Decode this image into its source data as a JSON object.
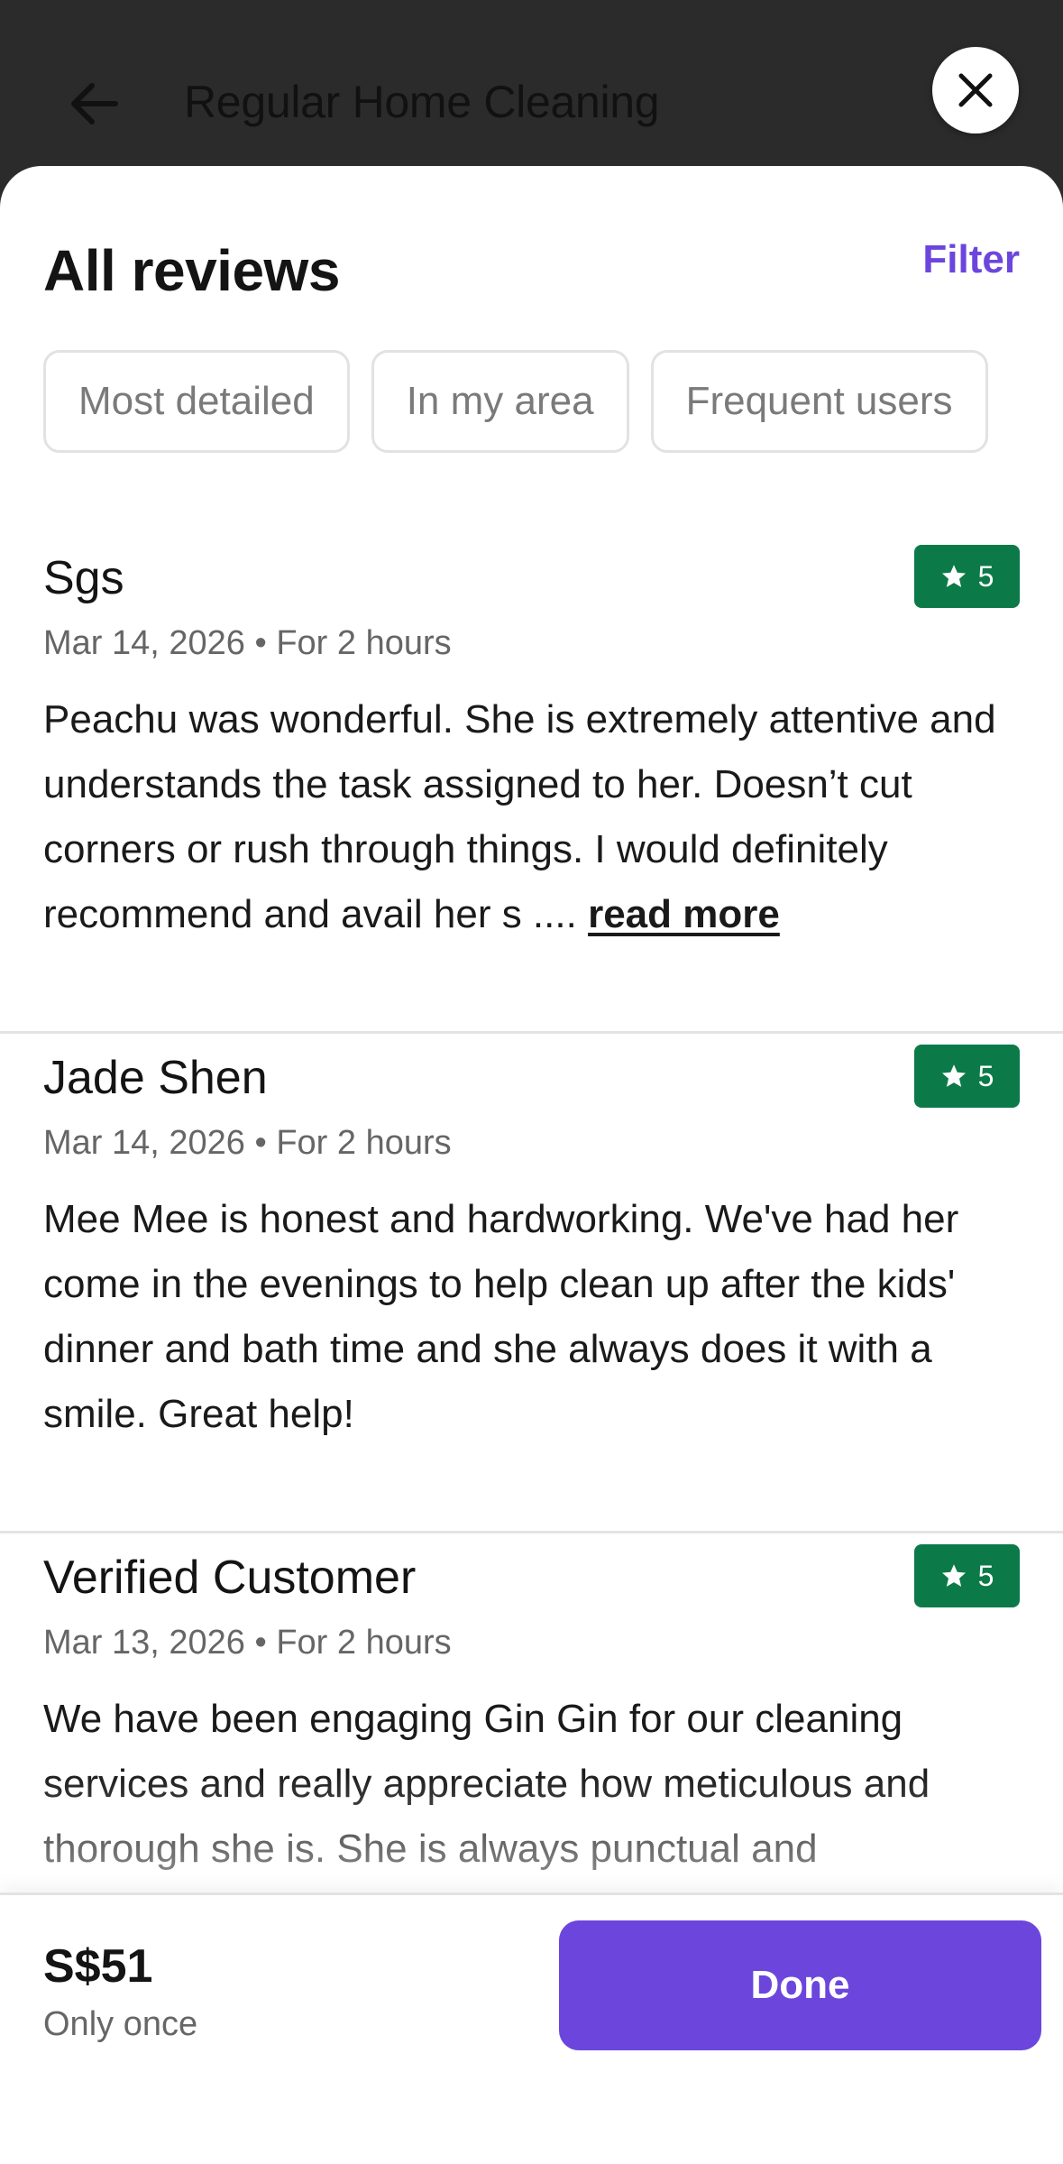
{
  "header": {
    "title": "Regular Home Cleaning",
    "back_icon": "arrow-left-icon",
    "close_icon": "close-icon"
  },
  "sheet": {
    "title": "All reviews",
    "filter_label": "Filter",
    "chips": [
      {
        "label": "Most detailed"
      },
      {
        "label": "In my area"
      },
      {
        "label": "Frequent users"
      }
    ]
  },
  "reviews": [
    {
      "name": "Sgs",
      "meta": "Mar 14, 2026 • For 2 hours",
      "rating": "5",
      "text": "Peachu was wonderful. She is extremely attentive and understands the task assigned to her. Doesn’t cut corners or rush through things. I would definitely recommend and avail her s ....",
      "read_more": "read more"
    },
    {
      "name": "Jade Shen",
      "meta": "Mar 14, 2026 • For 2 hours",
      "rating": "5",
      "text": "Mee Mee is honest and hardworking. We've had her come in the evenings to help clean up after the kids' dinner and bath time and she always does it with a smile. Great help!"
    },
    {
      "name": "Verified Customer",
      "meta": "Mar 13, 2026 • For 2 hours",
      "rating": "5",
      "text": "We have been engaging Gin Gin for our cleaning services and really appreciate how meticulous and thorough she is. She is always punctual and"
    }
  ],
  "footer": {
    "price": "S$51",
    "price_note": "Only once",
    "done_label": "Done"
  },
  "colors": {
    "accent": "#6c46dc",
    "rating_badge": "#0b7a48",
    "topbar": "#2b2b2b"
  }
}
